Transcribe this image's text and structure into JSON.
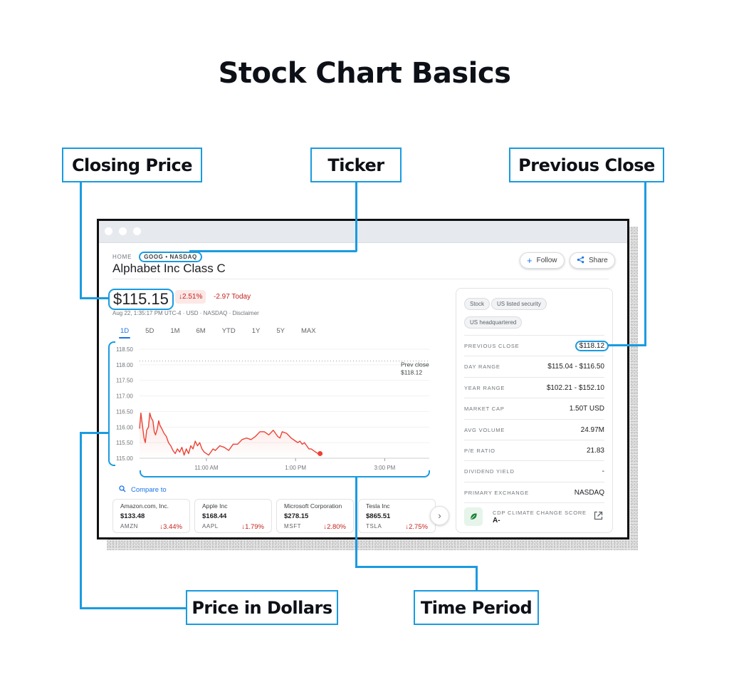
{
  "infographic": {
    "title": "Stock Chart Basics",
    "callouts": {
      "closing_price": "Closing Price",
      "ticker": "Ticker",
      "previous_close": "Previous Close",
      "price_in_dollars": "Price in Dollars",
      "time_period": "Time Period"
    },
    "accent_color": "#1a9be0"
  },
  "page": {
    "breadcrumb": {
      "home": "HOME",
      "ticker": "GOOG • NASDAQ"
    },
    "company_name": "Alphabet Inc Class C",
    "buttons": {
      "follow": "Follow",
      "share": "Share",
      "follow_icon": "plus-icon",
      "share_icon": "share-icon"
    },
    "quote": {
      "price": "$115.15",
      "change_pct": "2.51%",
      "change_today": "-2.97 Today",
      "meta": "Aug 22, 1:35:17 PM UTC-4 · USD · NASDAQ · Disclaimer",
      "down_color": "#c5221f"
    },
    "time_tabs": [
      "1D",
      "5D",
      "1M",
      "6M",
      "YTD",
      "1Y",
      "5Y",
      "MAX"
    ],
    "active_tab": "1D",
    "compare_label": "Compare to",
    "peers": [
      {
        "name": "Amazon.com, Inc.",
        "price": "$133.48",
        "symbol": "AMZN",
        "change": "3.44%"
      },
      {
        "name": "Apple Inc",
        "price": "$168.44",
        "symbol": "AAPL",
        "change": "1.79%"
      },
      {
        "name": "Microsoft Corporation",
        "price": "$278.15",
        "symbol": "MSFT",
        "change": "2.80%"
      },
      {
        "name": "Tesla Inc",
        "price": "$865.51",
        "symbol": "TSLA",
        "change": "2.75%"
      }
    ],
    "side_panel": {
      "chips": [
        "Stock",
        "US listed security",
        "US headquartered"
      ],
      "stats": [
        {
          "label": "PREVIOUS CLOSE",
          "value": "$118.12"
        },
        {
          "label": "DAY RANGE",
          "value": "$115.04 - $116.50"
        },
        {
          "label": "YEAR RANGE",
          "value": "$102.21 - $152.10"
        },
        {
          "label": "MARKET CAP",
          "value": "1.50T USD"
        },
        {
          "label": "AVG VOLUME",
          "value": "24.97M"
        },
        {
          "label": "P/E RATIO",
          "value": "21.83"
        },
        {
          "label": "DIVIDEND YIELD",
          "value": "-"
        },
        {
          "label": "PRIMARY EXCHANGE",
          "value": "NASDAQ"
        }
      ],
      "cdp": {
        "label": "CDP CLIMATE CHANGE SCORE",
        "value": "A-"
      }
    }
  },
  "chart_data": {
    "type": "line",
    "title": "",
    "xlabel": "",
    "ylabel": "",
    "y_ticks": [
      "118.50",
      "118.00",
      "117.50",
      "117.00",
      "116.50",
      "116.00",
      "115.50",
      "115.00"
    ],
    "ylim": [
      115.0,
      118.5
    ],
    "x_ticks": [
      {
        "label": "11:00 AM",
        "hour": 11.0
      },
      {
        "label": "1:00 PM",
        "hour": 13.0
      },
      {
        "label": "3:00 PM",
        "hour": 15.0
      }
    ],
    "xlim_hours": [
      9.5,
      16.0
    ],
    "reference_line": {
      "label": "Prev close",
      "value_label": "$118.12",
      "value": 118.12
    },
    "line_color": "#ea4335",
    "series": [
      {
        "name": "GOOG",
        "hours": [
          9.5,
          9.53,
          9.56,
          9.6,
          9.63,
          9.66,
          9.7,
          9.73,
          9.76,
          9.8,
          9.83,
          9.86,
          9.9,
          9.93,
          9.96,
          10.0,
          10.05,
          10.1,
          10.15,
          10.2,
          10.25,
          10.3,
          10.35,
          10.4,
          10.45,
          10.5,
          10.55,
          10.6,
          10.65,
          10.7,
          10.75,
          10.8,
          10.85,
          10.9,
          10.95,
          11.0,
          11.05,
          11.1,
          11.15,
          11.2,
          11.3,
          11.4,
          11.5,
          11.6,
          11.7,
          11.8,
          11.9,
          12.0,
          12.1,
          12.2,
          12.3,
          12.4,
          12.5,
          12.55,
          12.6,
          12.65,
          12.7,
          12.8,
          12.9,
          13.0,
          13.05,
          13.1,
          13.15,
          13.2,
          13.25,
          13.3,
          13.35,
          13.4,
          13.45,
          13.5,
          13.55
        ],
        "values": [
          115.95,
          116.45,
          116.1,
          115.65,
          115.5,
          115.9,
          116.0,
          116.45,
          116.3,
          116.2,
          115.85,
          115.75,
          115.95,
          116.2,
          116.05,
          115.95,
          115.8,
          115.7,
          115.5,
          115.4,
          115.25,
          115.15,
          115.3,
          115.2,
          115.35,
          115.1,
          115.3,
          115.15,
          115.4,
          115.3,
          115.55,
          115.4,
          115.5,
          115.3,
          115.2,
          115.15,
          115.1,
          115.2,
          115.3,
          115.25,
          115.4,
          115.35,
          115.25,
          115.45,
          115.45,
          115.6,
          115.65,
          115.6,
          115.7,
          115.85,
          115.85,
          115.75,
          115.9,
          115.8,
          115.7,
          115.65,
          115.85,
          115.8,
          115.65,
          115.55,
          115.5,
          115.55,
          115.45,
          115.5,
          115.4,
          115.3,
          115.3,
          115.25,
          115.2,
          115.15,
          115.15
        ]
      }
    ]
  }
}
